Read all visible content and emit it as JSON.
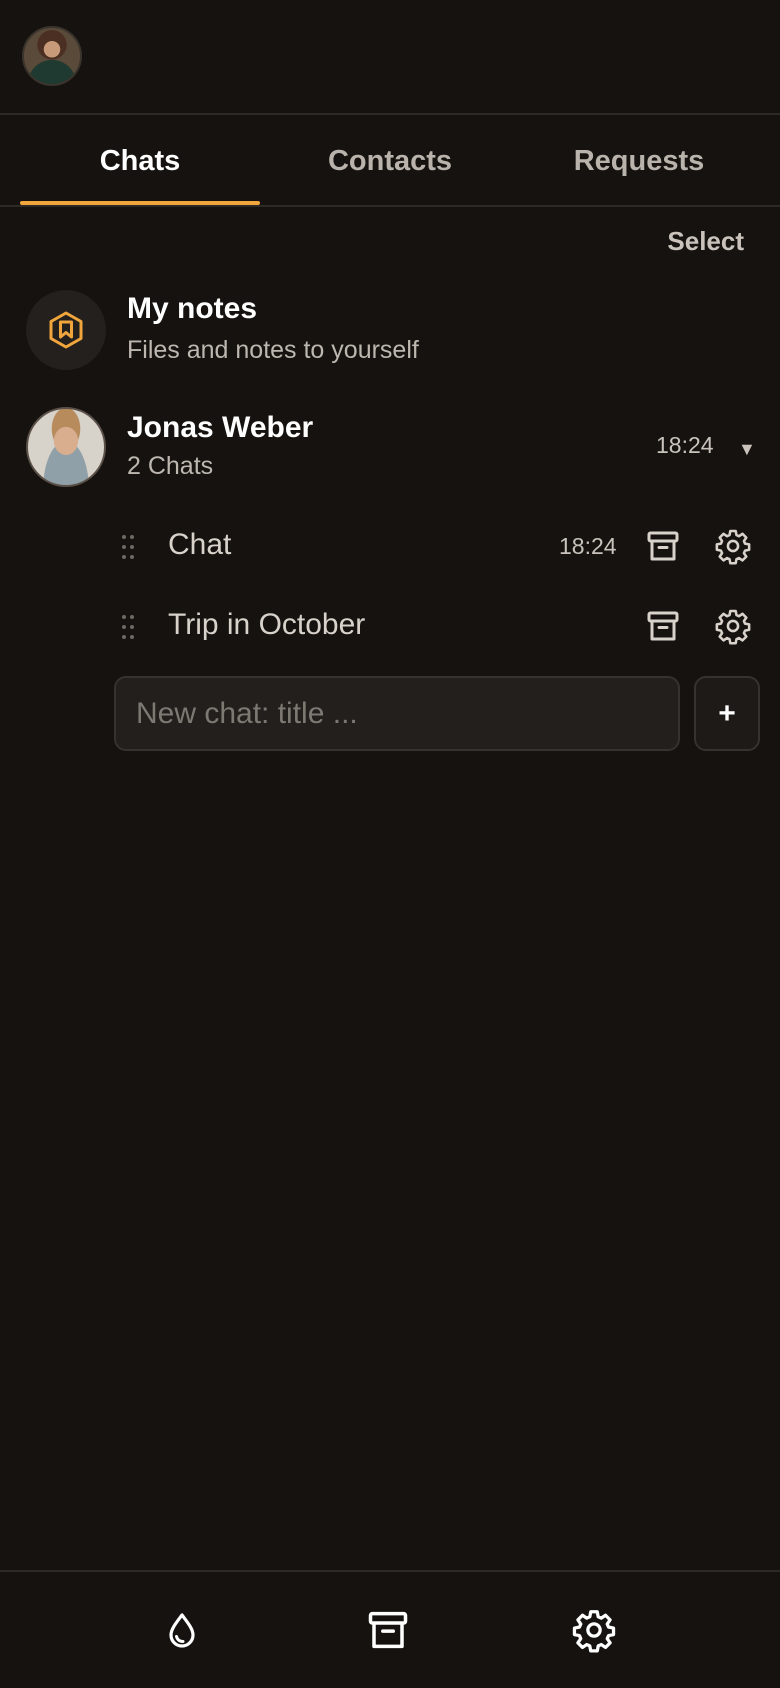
{
  "tabs": [
    {
      "label": "Chats",
      "active": true
    },
    {
      "label": "Contacts",
      "active": false
    },
    {
      "label": "Requests",
      "active": false
    }
  ],
  "select_label": "Select",
  "my_notes": {
    "title": "My notes",
    "subtitle": "Files and notes to yourself",
    "icon": "bookmark-hexagon-icon"
  },
  "contact": {
    "name": "Jonas Weber",
    "subtitle": "2 Chats",
    "time": "18:24",
    "caret": "▼"
  },
  "chats": [
    {
      "title": "Chat",
      "time": "18:24"
    },
    {
      "title": "Trip in October",
      "time": ""
    }
  ],
  "new_chat": {
    "placeholder": "New chat: title ...",
    "add_label": "+"
  },
  "bottom_nav": [
    "drop-icon",
    "archive-icon",
    "gear-icon"
  ],
  "colors": {
    "background": "#15120f",
    "accent": "#f0a63c",
    "divider": "#2c2926"
  }
}
